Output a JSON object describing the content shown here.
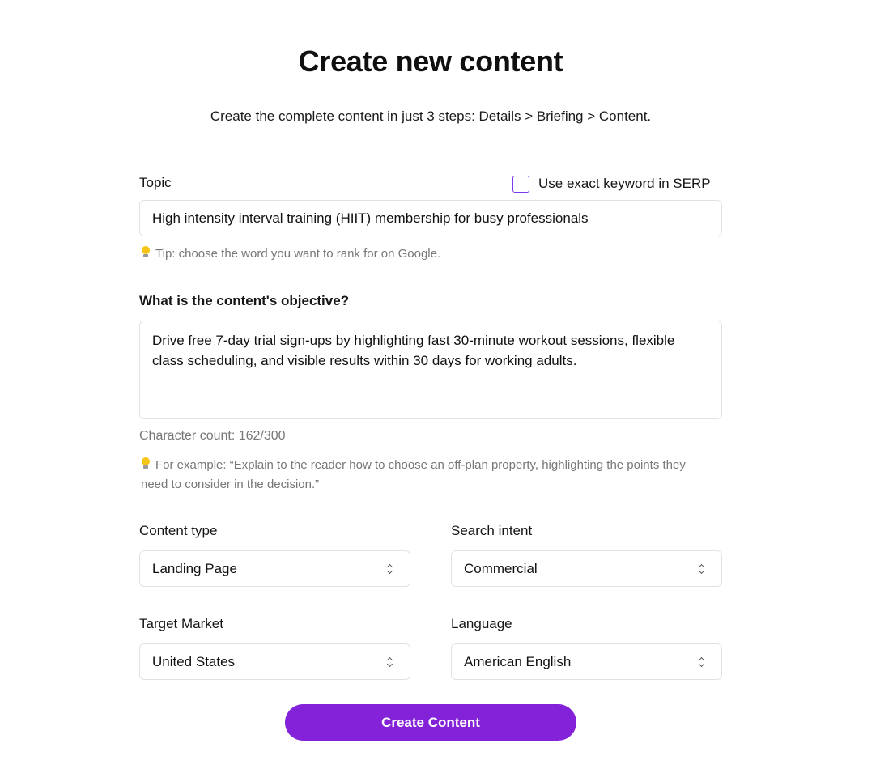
{
  "header": {
    "title": "Create new content",
    "subtitle": "Create the complete content in just 3 steps: Details > Briefing > Content."
  },
  "topic": {
    "label": "Topic",
    "exact_keyword_label": "Use exact keyword in SERP",
    "exact_keyword_checked": false,
    "value": "High intensity interval training (HIIT) membership for busy professionals",
    "tip": "Tip: choose the word you want to rank for on Google."
  },
  "objective": {
    "label": "What is the content's objective?",
    "value": "Drive free 7-day trial sign-ups by highlighting fast 30-minute workout sessions, flexible class scheduling, and visible results within 30 days for working adults.",
    "character_count": "Character count: 162/300",
    "example": "For example: “Explain to the reader how to choose an off-plan property, highlighting the points they need to consider in the decision.”"
  },
  "content_type": {
    "label": "Content type",
    "value": "Landing Page"
  },
  "search_intent": {
    "label": "Search intent",
    "value": "Commercial"
  },
  "target_market": {
    "label": "Target Market",
    "value": "United States"
  },
  "language": {
    "label": "Language",
    "value": "American English"
  },
  "submit": {
    "label": "Create Content"
  },
  "colors": {
    "accent": "#8322d8",
    "checkbox_border": "#7c3aed"
  },
  "icons": {
    "tip": "lightbulb-icon",
    "select": "chevron-up-down-icon"
  }
}
